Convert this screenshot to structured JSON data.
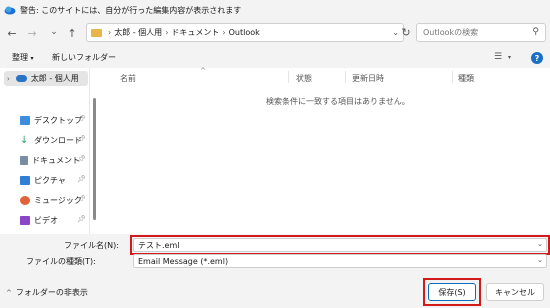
{
  "title": "警告: このサイトには、自分が行った編集内容が表示されます",
  "nav": {
    "back_icon": "←",
    "forward_icon": "→",
    "down_icon": "⌄",
    "up_icon": "↑",
    "breadcrumb": [
      "太郎 - 個人用",
      "ドキュメント",
      "Outlook"
    ],
    "search_placeholder": "Outlookの検索",
    "refresh_icon": "↻"
  },
  "toolbar": {
    "organize": "整理",
    "new_folder": "新しいフォルダー"
  },
  "sidebar": {
    "top_item": "太郎 - 個人用",
    "items": [
      {
        "label": "デスクトップ",
        "color": "#3c8ddc"
      },
      {
        "label": "ダウンロード",
        "color": "#2fa36b"
      },
      {
        "label": "ドキュメント",
        "color": "#7a8ca3"
      },
      {
        "label": "ピクチャ",
        "color": "#2f7fd6"
      },
      {
        "label": "ミュージック",
        "color": "#e0623a"
      },
      {
        "label": "ビデオ",
        "color": "#8a45c9"
      }
    ]
  },
  "columns": [
    "名前",
    "状態",
    "更新日時",
    "種類"
  ],
  "empty_message": "検索条件に一致する項目はありません。",
  "fields": {
    "filename_label": "ファイル名(N):",
    "filename_value": "テスト.eml",
    "filetype_label": "ファイルの種類(T):",
    "filetype_value": "Email Message (*.eml)"
  },
  "footer": {
    "hide_folders": "フォルダーの非表示",
    "save": "保存(S)",
    "cancel": "キャンセル"
  },
  "colors": {
    "highlight": "#d21a1a",
    "accent": "#0f6cbd"
  }
}
